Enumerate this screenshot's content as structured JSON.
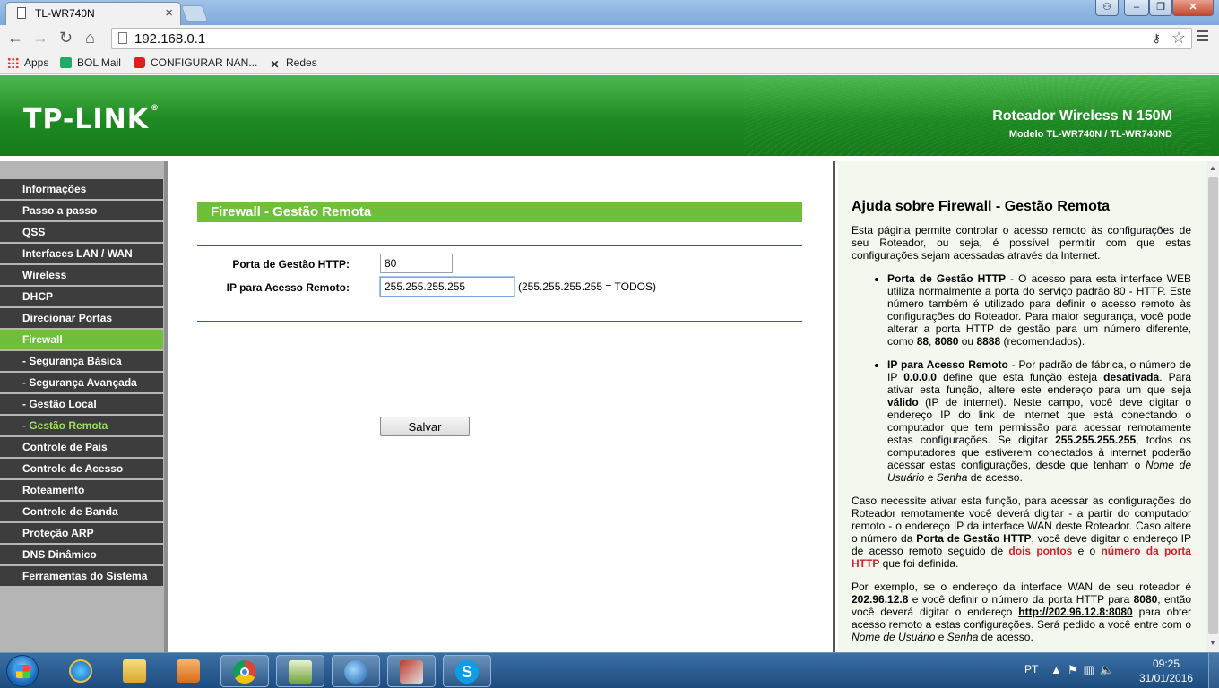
{
  "browser": {
    "tab_title": "TL-WR740N",
    "tab_close": "×",
    "url": "192.168.0.1",
    "bookmarks": [
      "Apps",
      "BOL Mail",
      "CONFIGURAR NAN...",
      "Redes"
    ]
  },
  "banner": {
    "brand": "TP-LINK",
    "brand_mark": "®",
    "product": "Roteador Wireless N 150M",
    "model": "Modelo TL-WR740N / TL-WR740ND"
  },
  "sidebar": {
    "items": [
      "Informações",
      "Passo a passo",
      "QSS",
      "Interfaces LAN / WAN",
      "Wireless",
      "DHCP",
      "Direcionar Portas",
      "Firewall",
      "- Segurança Básica",
      "- Segurança Avançada",
      "- Gestão Local",
      "- Gestão Remota",
      "Controle de Pais",
      "Controle de Acesso",
      "Roteamento",
      "Controle de Banda",
      "Proteção ARP",
      "DNS Dinâmico",
      "Ferramentas do Sistema"
    ],
    "active_item": "Firewall",
    "active_subitem": "- Gestão Remota"
  },
  "main": {
    "title": "Firewall - Gestão Remota",
    "http_port_label": "Porta de Gestão HTTP:",
    "http_port_value": "80",
    "remote_ip_label": "IP para Acesso Remoto:",
    "remote_ip_value": "255.255.255.255",
    "remote_ip_hint": "(255.255.255.255 = TODOS)",
    "save_label": "Salvar"
  },
  "help": {
    "title": "Ajuda sobre Firewall - Gestão Remota",
    "intro": "Esta página permite controlar o acesso remoto às configurações de seu Roteador, ou seja, é possível permitir com que estas configurações sejam acessadas através da Internet.",
    "b1_term": "Porta de Gestão HTTP",
    "b1_text": " - O acesso para esta interface WEB utiliza normalmente a porta do serviço padrão 80 - HTTP. Este número também é utilizado para definir o acesso remoto às configurações do Roteador. Para maior segurança, você pode alterar a porta HTTP de gestão para um número diferente, como ",
    "b1_p88": "88",
    "b1_sep1": ", ",
    "b1_p8080": "8080",
    "b1_sep2": " ou ",
    "b1_p8888": "8888",
    "b1_end": " (recomendados).",
    "b2_term": "IP para Acesso Remoto",
    "b2_t1": " - Por padrão de fábrica, o número de IP ",
    "b2_ip0": "0.0.0.0",
    "b2_t2": " define que esta função esteja ",
    "b2_disabled": "desativada",
    "b2_t3": ". Para ativar esta função, altere este endereço para um que seja ",
    "b2_valid": "válido",
    "b2_t4": " (IP de internet). Neste campo, você deve digitar o endereço IP do link de internet que está conectando o computador que tem permissão para acessar remotamente estas configurações. Se digitar ",
    "b2_all": "255.255.255.255",
    "b2_t5": ", todos os computadores que estiverem conectados à internet poderão acessar estas configurações, desde que tenham o ",
    "b2_user": "Nome de Usuário",
    "b2_t6": " e ",
    "b2_pass": "Senha",
    "b2_t7": " de acesso.",
    "p2_t1": "Caso necessite ativar esta função, para acessar as configurações do Roteador remotamente você deverá digitar - a partir do computador remoto - o endereço IP da interface WAN deste Roteador. Caso altere o número da ",
    "p2_port": "Porta de Gestão HTTP",
    "p2_t2": ", você deve digitar o endereço IP de acesso remoto seguido de ",
    "p2_colon": "dois pontos",
    "p2_t3": " e o ",
    "p2_portnum": "número da porta HTTP",
    "p2_t4": " que foi definida.",
    "p3_t1": "Por exemplo, se o endereço da interface WAN de seu roteador é ",
    "p3_ip": "202.96.12.8",
    "p3_t2": " e você definir o número da porta HTTP para ",
    "p3_port": "8080",
    "p3_t3": ", então você deverá digitar o endereço ",
    "p3_url": "http://202.96.12.8:8080",
    "p3_t4": " para obter acesso remoto a estas configurações. Será pedido a você entre com o ",
    "p3_user": "Nome de Usuário",
    "p3_t5": " e ",
    "p3_pass": "Senha",
    "p3_t6": " de acesso."
  },
  "taskbar": {
    "language": "PT",
    "time": "09:25",
    "date": "31/01/2016"
  },
  "colors": {
    "accent_green": "#6fbf3a",
    "sidebar_dark": "#3d3d3d",
    "help_red": "#d0202a"
  }
}
